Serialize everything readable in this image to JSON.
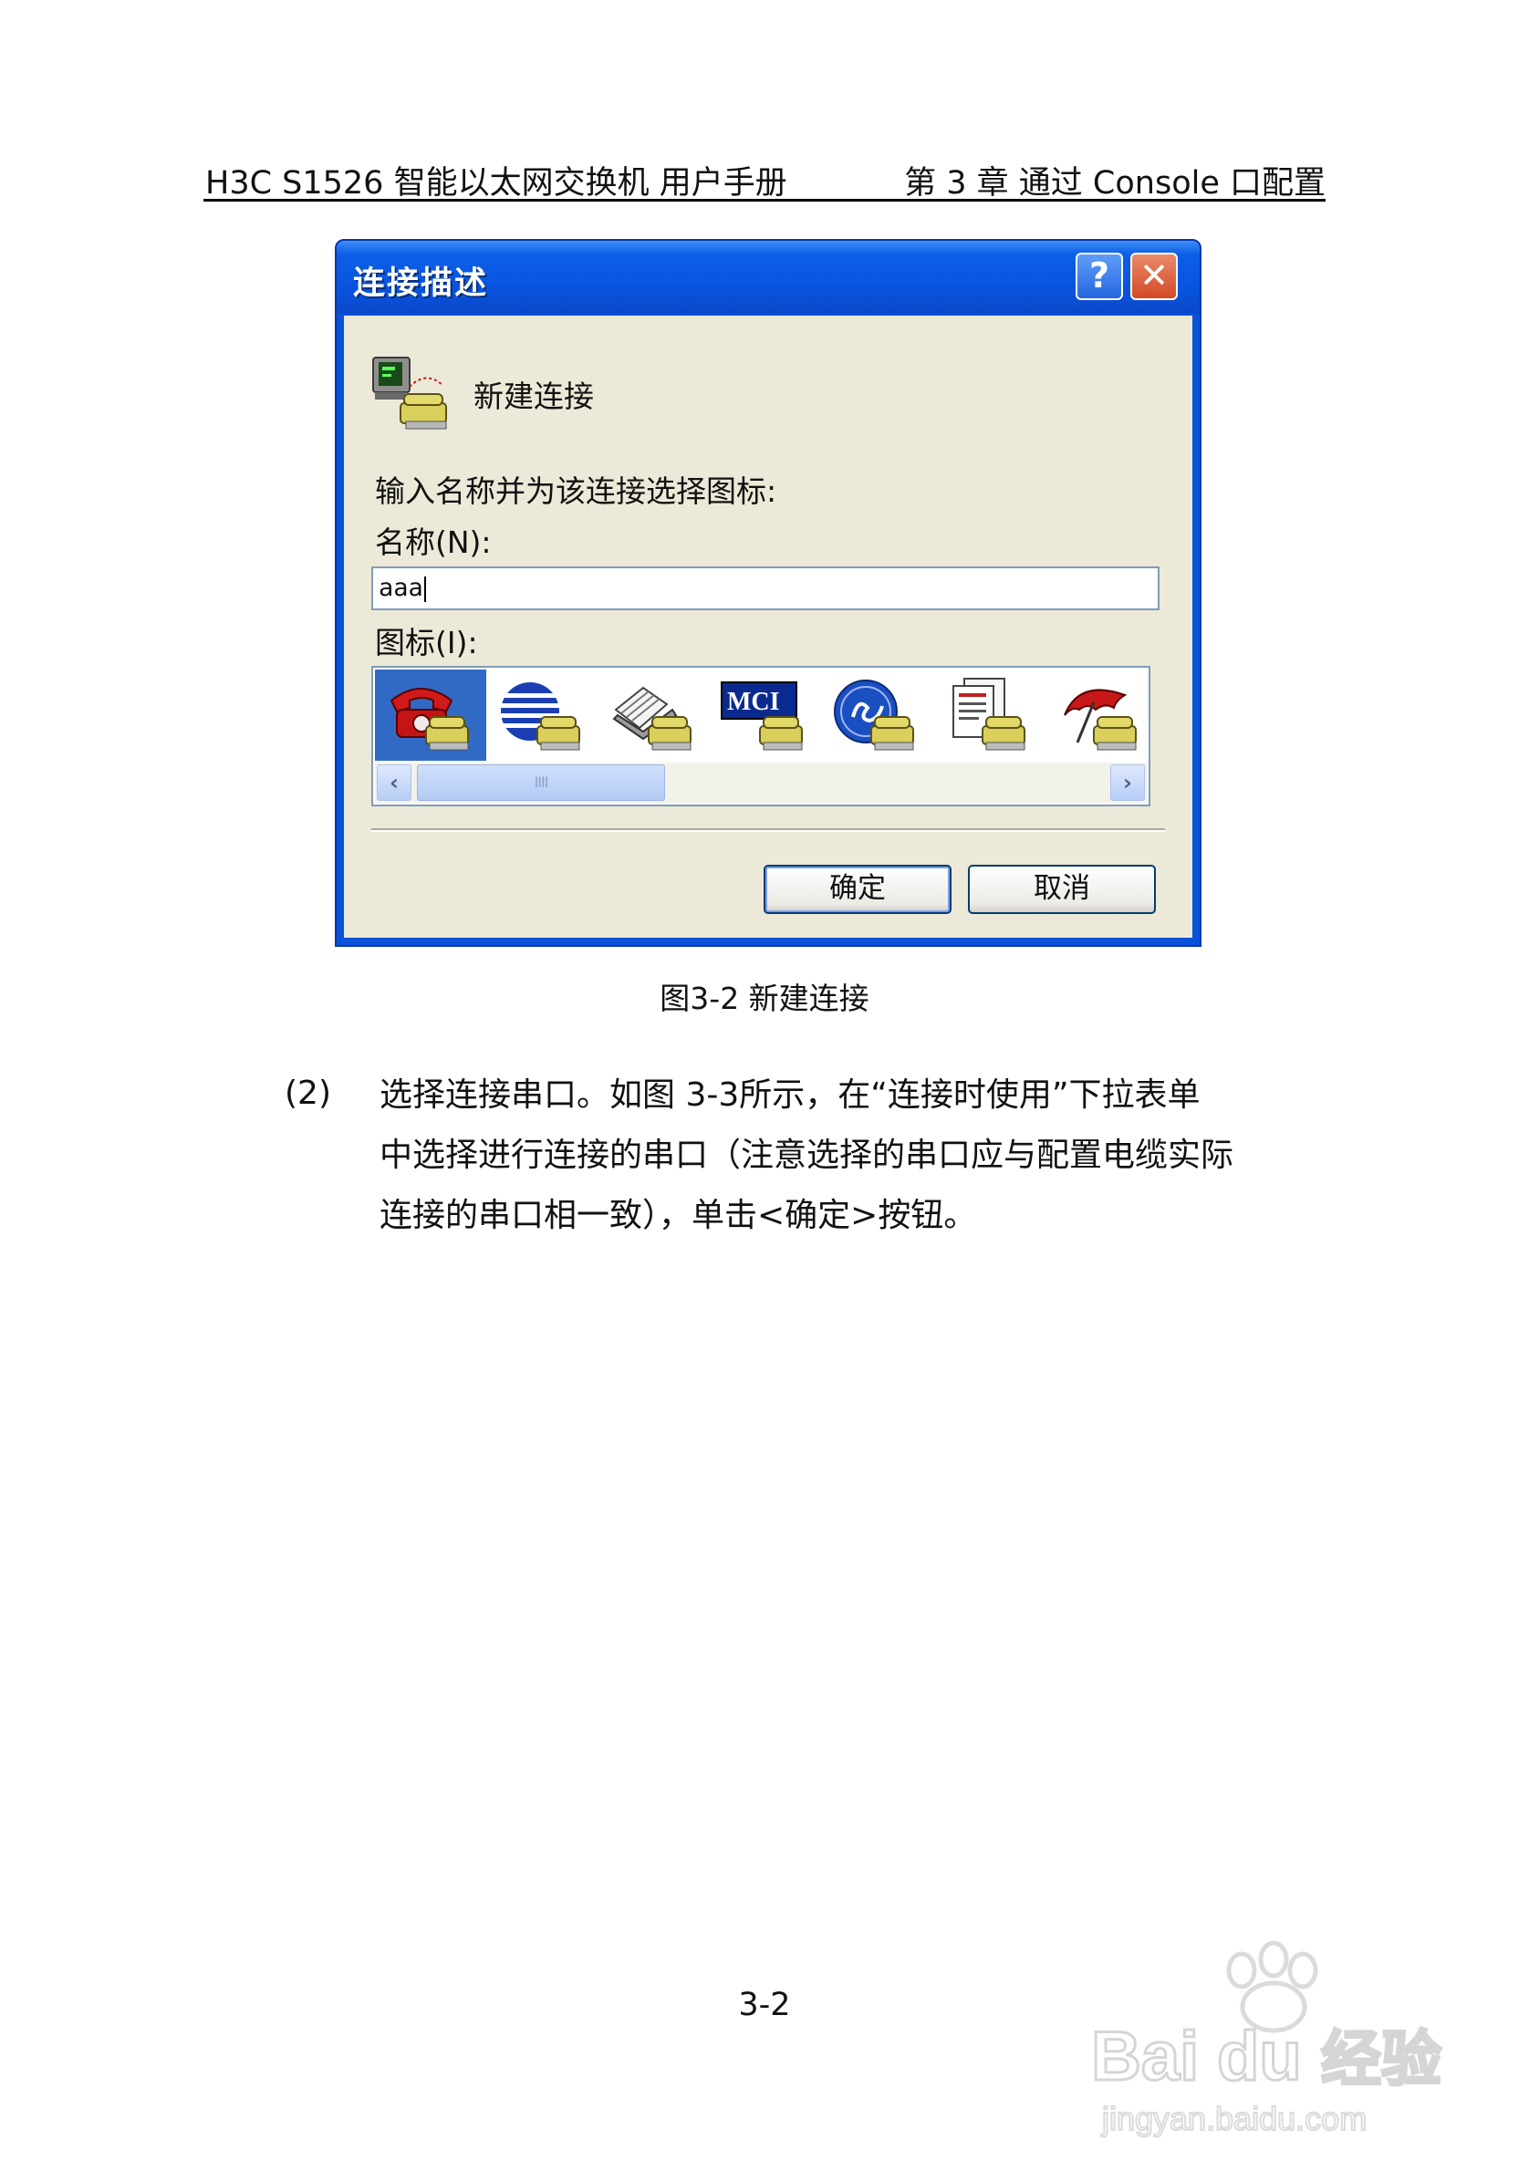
{
  "header": {
    "left": "H3C S1526 智能以太网交换机  用户手册",
    "right": "第 3 章  通过 Console 口配置"
  },
  "dialog": {
    "title": "连接描述",
    "help_glyph": "?",
    "close_glyph": "✕",
    "heading": "新建连接",
    "prompt": "输入名称并为该连接选择图标:",
    "name_label": "名称(N):",
    "name_value": "aaa",
    "icon_label": "图标(I):",
    "icons": [
      "red-phone-icon",
      "globe-stripes-icon",
      "fax-machine-icon",
      "mci-logo-icon",
      "ge-logo-icon",
      "documents-icon",
      "umbrella-icon"
    ],
    "scroll_thumb_grip": "IIII",
    "ok_label": "确定",
    "cancel_label": "取消"
  },
  "caption": "图3-2  新建连接",
  "step": {
    "number": "(2)",
    "lines": [
      "选择连接串口。如图 3-3所示，在“连接时使用”下拉表单",
      "中选择进行连接的串口（注意选择的串口应与配置电缆实际",
      "连接的串口相一致），单击<确定>按钮。"
    ]
  },
  "page_number": "3-2",
  "watermark": {
    "brand": "Bai du 经验",
    "url": "jingyan.baidu.com"
  },
  "colors": {
    "titlebar": "#0852dc",
    "dialog_face": "#ece9d8",
    "selection": "#316ac5"
  }
}
